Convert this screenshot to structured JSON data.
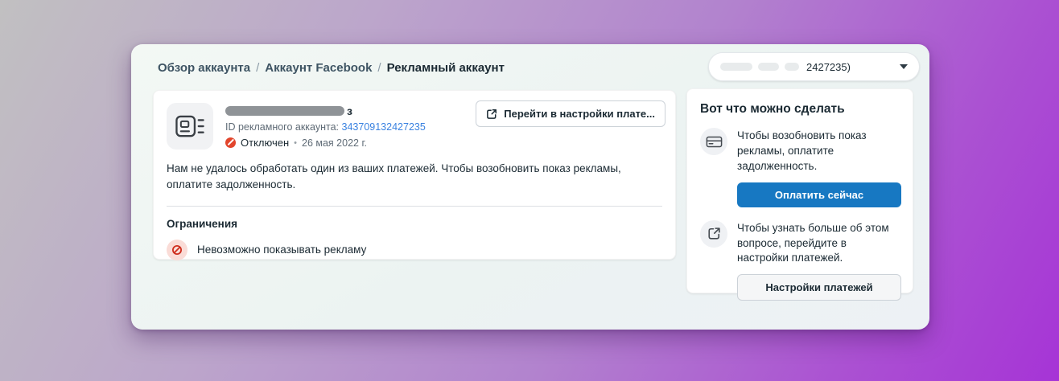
{
  "breadcrumb": {
    "separator": "/",
    "items": [
      {
        "label": "Обзор аккаунта"
      },
      {
        "label": "Аккаунт Facebook"
      },
      {
        "label": "Рекламный аккаунт"
      }
    ]
  },
  "account_selector": {
    "visible_suffix": "2427235)"
  },
  "main_card": {
    "name_visible_suffix": "з",
    "id_label": "ID рекламного аккаунта:",
    "id_value": "343709132427235",
    "status_label": "Отключен",
    "status_separator": "•",
    "status_date": "26 мая 2022 г.",
    "settings_button_label": "Перейти в настройки плате...",
    "description": "Нам не удалось обработать один из ваших платежей. Чтобы возобновить показ рекламы, оплатите задолженность.",
    "restrictions_title": "Ограничения",
    "restrictions": [
      {
        "label": "Невозможно показывать рекламу"
      }
    ]
  },
  "action_panel": {
    "title": "Вот что можно сделать",
    "items": [
      {
        "icon": "credit-card-icon",
        "text": "Чтобы возобновить показ рекламы, оплатите задолженность.",
        "button_label": "Оплатить сейчас"
      },
      {
        "icon": "external-link-icon",
        "text": "Чтобы узнать больше об этом вопросе, перейдите в настройки платежей.",
        "button_label": "Настройки платежей"
      }
    ]
  },
  "colors": {
    "accent_blue": "#1778c2",
    "link_blue": "#3a82e0",
    "status_red": "#e2452c",
    "restriction_icon_bg": "#fadcd7",
    "panel_bg": "#eef3f2"
  }
}
